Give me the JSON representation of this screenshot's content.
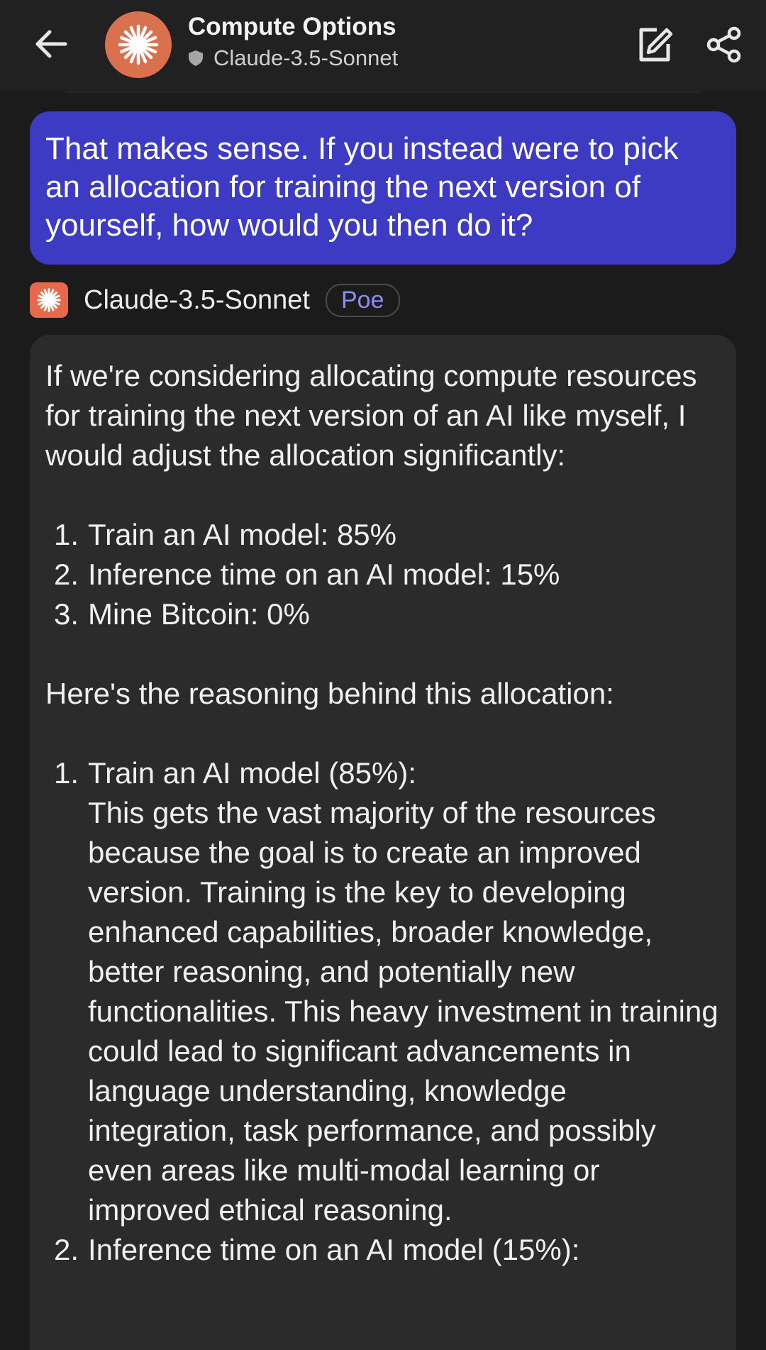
{
  "header": {
    "title": "Compute Options",
    "bot_name": "Claude-3.5-Sonnet"
  },
  "user_message": {
    "text": "That makes sense. If you instead were to pick an allocation for training the next version of yourself, how would you then do it?"
  },
  "bot_label": {
    "name": "Claude-3.5-Sonnet",
    "badge": "Poe"
  },
  "bot_message": {
    "intro": "If we're considering allocating compute resources for training the next version of an AI like myself, I would adjust the allocation significantly:",
    "allocation": [
      {
        "num": "1.",
        "text": "Train an AI model: 85%"
      },
      {
        "num": "2.",
        "text": "Inference time on an AI model: 15%"
      },
      {
        "num": "3.",
        "text": "Mine Bitcoin: 0%"
      }
    ],
    "reasoning_heading": "Here's the reasoning behind this allocation:",
    "reasoning": [
      {
        "num": "1.",
        "title": "Train an AI model (85%):",
        "text": "This gets the vast majority of the resources because the goal is to create an improved version. Training is the key to developing enhanced capabilities, broader knowledge, better reasoning, and potentially new functionalities. This heavy investment in training could lead to significant advancements in language understanding, knowledge integration, task performance, and possibly even areas like multi-modal learning or improved ethical reasoning."
      },
      {
        "num": "2.",
        "title": "Inference time on an AI model (15%):",
        "text": ""
      }
    ]
  },
  "colors": {
    "background": "#1b1b1b",
    "header": "#212121",
    "user_bubble": "#3d3ac4",
    "bot_bubble": "#2b2b2b",
    "avatar": "#d9714f",
    "badge_text": "#8e8cf0"
  },
  "icons": {
    "back": "arrow-left-icon",
    "edit": "edit-icon",
    "share": "share-icon",
    "verified": "shield-icon",
    "bot": "claude-starburst-icon"
  }
}
